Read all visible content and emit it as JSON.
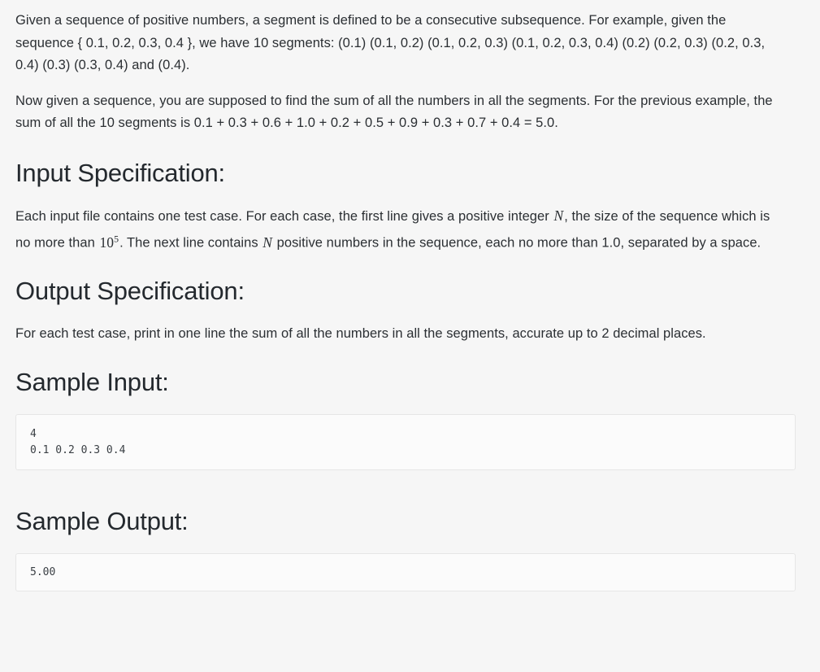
{
  "problem": {
    "paragraphs": [
      {
        "id": "definition",
        "parts": [
          {
            "type": "text",
            "value": "Given a sequence of positive numbers, a segment is defined to be a consecutive subsequence. For example, given the sequence { 0.1, 0.2, 0.3, 0.4 }, we have 10 segments: (0.1) (0.1, 0.2) (0.1, 0.2, 0.3) (0.1, 0.2, 0.3, 0.4) (0.2) (0.2, 0.3) (0.2, 0.3, 0.4) (0.3) (0.3, 0.4) and (0.4)."
          }
        ]
      },
      {
        "id": "task",
        "parts": [
          {
            "type": "text",
            "value": "Now given a sequence, you are supposed to find the sum of all the numbers in all the segments. For the previous example, the sum of all the 10 segments is 0.1 + 0.3 + 0.6 + 1.0 + 0.2 + 0.5 + 0.9 + 0.3 + 0.7 + 0.4 = 5.0."
          }
        ]
      }
    ],
    "input_section": {
      "heading": "Input Specification:",
      "text_1": "Each input file contains one test case. For each case, the first line gives a positive integer ",
      "var_n_1": "N",
      "text_2": ", the size of the sequence which is no more than ",
      "math_power_base": "10",
      "math_power_exp": "5",
      "text_3": ". The next line contains ",
      "var_n_2": "N",
      "text_4": " positive numbers in the sequence, each no more than 1.0, separated by a space."
    },
    "output_section": {
      "heading": "Output Specification:",
      "text": "For each test case, print in one line the sum of all the numbers in all the segments, accurate up to 2 decimal places."
    },
    "sample_input": {
      "heading": "Sample Input:",
      "code": "4\n0.1 0.2 0.3 0.4"
    },
    "sample_output": {
      "heading": "Sample Output:",
      "code": "5.00"
    }
  },
  "theme": {
    "page_background": "#f6f6f6",
    "text_color": "#2b2f33",
    "heading_color": "#24292e",
    "code_background": "#fbfbfb",
    "code_border": "#e6e6e6",
    "code_text": "#3a3f44"
  }
}
